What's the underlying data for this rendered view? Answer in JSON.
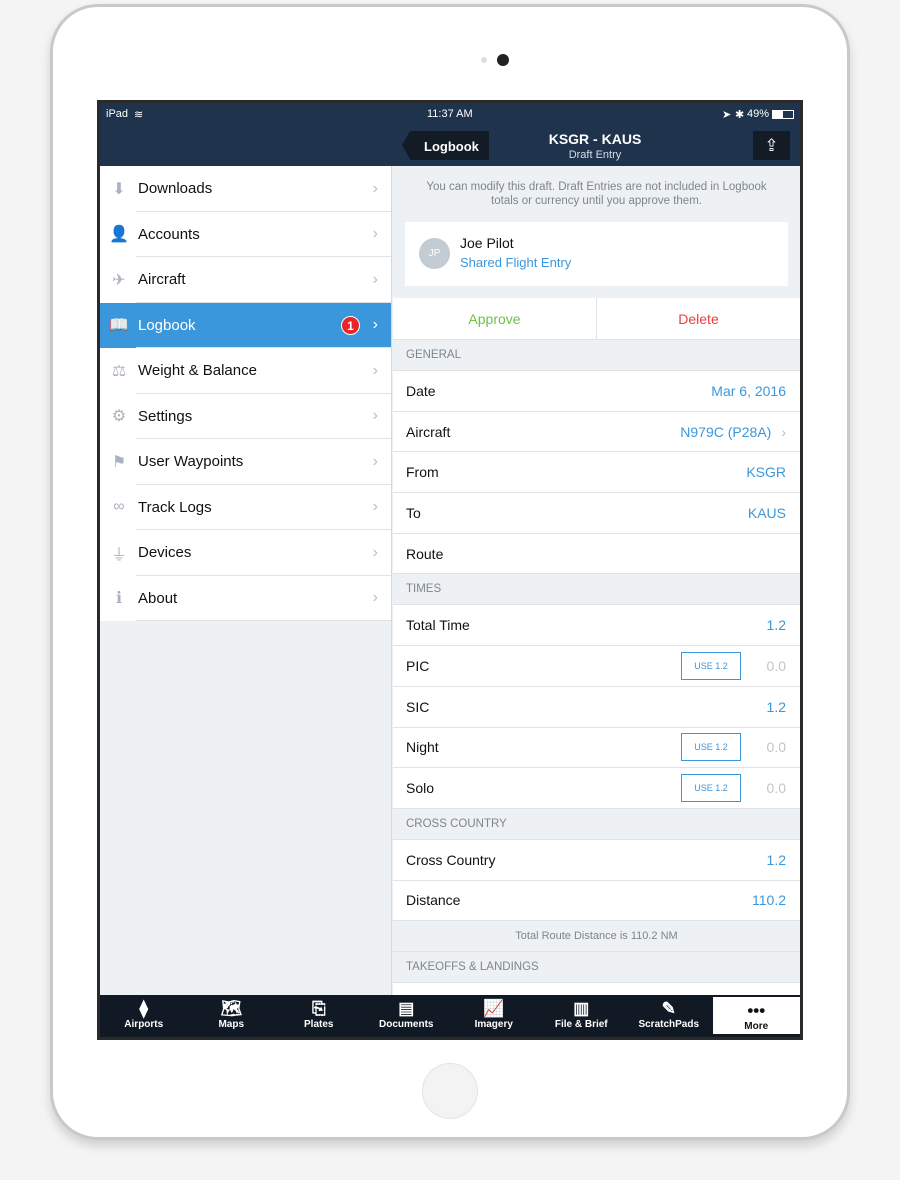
{
  "status": {
    "device": "iPad",
    "time": "11:37 AM",
    "battery": "49%"
  },
  "nav": {
    "back": "Logbook",
    "title": "KSGR - KAUS",
    "subtitle": "Draft Entry",
    "share_icon": "share-icon"
  },
  "sidebar": {
    "items": [
      {
        "label": "Downloads",
        "icon": "download-icon",
        "glyph": "⬇"
      },
      {
        "label": "Accounts",
        "icon": "person-icon",
        "glyph": "👤"
      },
      {
        "label": "Aircraft",
        "icon": "airplane-icon",
        "glyph": "✈"
      },
      {
        "label": "Logbook",
        "icon": "book-icon",
        "glyph": "📖",
        "active": true,
        "badge": "1"
      },
      {
        "label": "Weight & Balance",
        "icon": "weight-icon",
        "glyph": "⚖"
      },
      {
        "label": "Settings",
        "icon": "gear-icon",
        "glyph": "⚙"
      },
      {
        "label": "User Waypoints",
        "icon": "flag-icon",
        "glyph": "⚑"
      },
      {
        "label": "Track Logs",
        "icon": "tracklog-icon",
        "glyph": "∞"
      },
      {
        "label": "Devices",
        "icon": "plug-icon",
        "glyph": "⏚"
      },
      {
        "label": "About",
        "icon": "info-icon",
        "glyph": "ℹ"
      }
    ]
  },
  "main": {
    "notice": "You can modify this draft. Draft Entries are not included in Logbook totals or currency until you approve them.",
    "pilot": {
      "initials": "JP",
      "name": "Joe Pilot",
      "subtitle": "Shared Flight Entry"
    },
    "approve": "Approve",
    "delete": "Delete",
    "general": {
      "header": "GENERAL",
      "rows": [
        {
          "label": "Date",
          "value": "Mar 6, 2016"
        },
        {
          "label": "Aircraft",
          "value": "N979C (P28A)"
        },
        {
          "label": "From",
          "value": "KSGR"
        },
        {
          "label": "To",
          "value": "KAUS"
        },
        {
          "label": "Route",
          "value": ""
        }
      ]
    },
    "times": {
      "header": "TIMES",
      "rows": [
        {
          "label": "Total Time",
          "value": "1.2"
        },
        {
          "label": "PIC",
          "value": "0.0",
          "use": "USE 1.2"
        },
        {
          "label": "SIC",
          "value": "1.2"
        },
        {
          "label": "Night",
          "value": "0.0",
          "use": "USE 1.2"
        },
        {
          "label": "Solo",
          "value": "0.0",
          "use": "USE 1.2"
        }
      ]
    },
    "cross": {
      "header": "CROSS COUNTRY",
      "rows": [
        {
          "label": "Cross Country",
          "value": "1.2"
        },
        {
          "label": "Distance",
          "value": "110.2"
        }
      ],
      "note": "Total Route Distance is 110.2 NM"
    },
    "takeoffs": {
      "header": "TAKEOFFS & LANDINGS"
    }
  },
  "tabs": [
    {
      "label": "Airports",
      "icon": "airports-icon",
      "glyph": "⧫"
    },
    {
      "label": "Maps",
      "icon": "map-icon",
      "glyph": "🗺"
    },
    {
      "label": "Plates",
      "icon": "plates-icon",
      "glyph": "⎘"
    },
    {
      "label": "Documents",
      "icon": "documents-icon",
      "glyph": "▤"
    },
    {
      "label": "Imagery",
      "icon": "imagery-icon",
      "glyph": "📈"
    },
    {
      "label": "File & Brief",
      "icon": "file-brief-icon",
      "glyph": "▥"
    },
    {
      "label": "ScratchPads",
      "icon": "scratchpad-icon",
      "glyph": "✎"
    },
    {
      "label": "More",
      "icon": "more-icon",
      "glyph": "•••",
      "active": true
    }
  ],
  "colors": {
    "accent": "#3a97dc",
    "nav": "#1f344c",
    "approve": "#6cc24a",
    "delete": "#e8413c",
    "badge": "#e8252b"
  }
}
